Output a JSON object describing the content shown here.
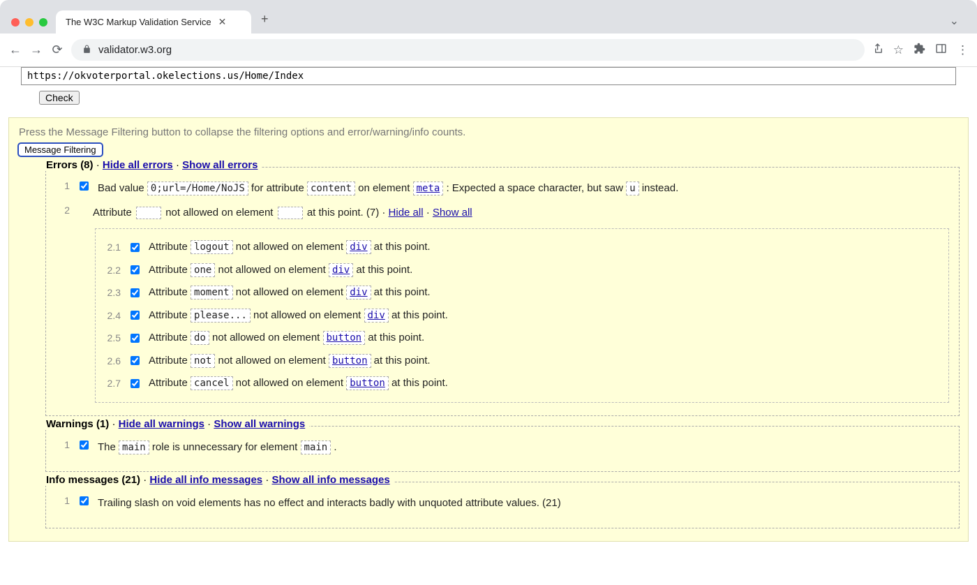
{
  "browser": {
    "tab_title": "The W3C Markup Validation Service",
    "url_display": "validator.w3.org"
  },
  "form": {
    "url_value": "https://okvoterportal.okelections.us/Home/Index",
    "check_button": "Check"
  },
  "filter": {
    "hint": "Press the Message Filtering button to collapse the filtering options and error/warning/info counts.",
    "button": "Message Filtering"
  },
  "errors": {
    "legend": "Errors (8)",
    "hide_all": "Hide all errors",
    "show_all": "Show all errors",
    "item1": {
      "idx": "1",
      "pre": "Bad value ",
      "code1": "0;url=/Home/NoJS",
      "mid1": " for attribute ",
      "code2": "content",
      "mid2": " on element ",
      "code3": "meta",
      "mid3": ": Expected a space character, but saw ",
      "code4": "u",
      "post": " instead."
    },
    "item2": {
      "idx": "2",
      "pre": "Attribute ",
      "mid1": " not allowed on element ",
      "post": " at this point. (7) · ",
      "hide": "Hide all",
      "sep": " · ",
      "show": "Show all"
    },
    "subs": [
      {
        "idx": "2.1",
        "attr": "logout",
        "el": "div"
      },
      {
        "idx": "2.2",
        "attr": "one",
        "el": "div"
      },
      {
        "idx": "2.3",
        "attr": "moment",
        "el": "div"
      },
      {
        "idx": "2.4",
        "attr": "please...",
        "el": "div"
      },
      {
        "idx": "2.5",
        "attr": "do",
        "el": "button"
      },
      {
        "idx": "2.6",
        "attr": "not",
        "el": "button"
      },
      {
        "idx": "2.7",
        "attr": "cancel",
        "el": "button"
      }
    ],
    "sub_pre": "Attribute ",
    "sub_mid": " not allowed on element ",
    "sub_post": " at this point."
  },
  "warnings": {
    "legend": "Warnings (1)",
    "hide_all": "Hide all warnings",
    "show_all": "Show all warnings",
    "item1": {
      "idx": "1",
      "pre": "The ",
      "code1": "main",
      "mid": " role is unnecessary for element ",
      "code2": "main",
      "post": "."
    }
  },
  "info": {
    "legend": "Info messages (21)",
    "hide_all": "Hide all info messages",
    "show_all": "Show all info messages",
    "item1": {
      "idx": "1",
      "text": "Trailing slash on void elements has no effect and interacts badly with unquoted attribute values. (21)"
    }
  }
}
